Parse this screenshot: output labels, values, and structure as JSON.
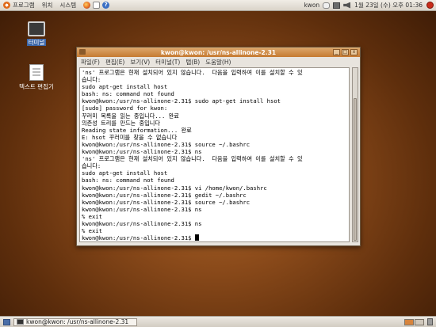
{
  "top_panel": {
    "menus": [
      "프로그램",
      "위치",
      "시스템"
    ],
    "user": "kwon",
    "clock": "1월 23일 (수) 오후 01:36"
  },
  "desktop": {
    "icons": [
      {
        "label": "터미널"
      },
      {
        "label": "텍스트 편집기"
      }
    ]
  },
  "terminal": {
    "title": "kwon@kwon: /usr/ns-allinone-2.31",
    "menu": [
      "파일(F)",
      "편집(E)",
      "보기(V)",
      "터미널(T)",
      "탭(B)",
      "도움말(H)"
    ],
    "window_buttons": [
      "_",
      "□",
      "x"
    ],
    "lines": [
      "'ns' 프로그램은 현재 설치되어 있지 않습니다.  다음을 입력하여 이를 설치할 수 있",
      "습니다:",
      "sudo apt-get install host",
      "bash: ns: command not found",
      "kwon@kwon:/usr/ns-allinone-2.31$ sudo apt-get install hsot",
      "[sudo] password for kwon:",
      "꾸러미 목록을 읽는 중입니다... 완료",
      "의존성 트리를 만드는 중입니다",
      "Reading state information... 완료",
      "E: hsot 꾸러미를 찾을 수 없습니다",
      "kwon@kwon:/usr/ns-allinone-2.31$ source ~/.bashrc",
      "kwon@kwon:/usr/ns-allinone-2.31$ ns",
      "'ns' 프로그램은 현재 설치되어 있지 않습니다.  다음을 입력하여 이를 설치할 수 있",
      "습니다:",
      "sudo apt-get install host",
      "bash: ns: command not found",
      "kwon@kwon:/usr/ns-allinone-2.31$ vi /home/kwon/.bashrc",
      "kwon@kwon:/usr/ns-allinone-2.31$ gedit ~/.bashrc",
      "kwon@kwon:/usr/ns-allinone-2.31$ source ~/.bashrc",
      "kwon@kwon:/usr/ns-allinone-2.31$ ns",
      "% exit",
      "kwon@kwon:/usr/ns-allinone-2.31$ ns",
      "% exit"
    ],
    "prompt": "kwon@kwon:/usr/ns-allinone-2.31$ "
  },
  "bottom_panel": {
    "task_label": "kwon@kwon: /usr/ns-allinone-2.31"
  }
}
